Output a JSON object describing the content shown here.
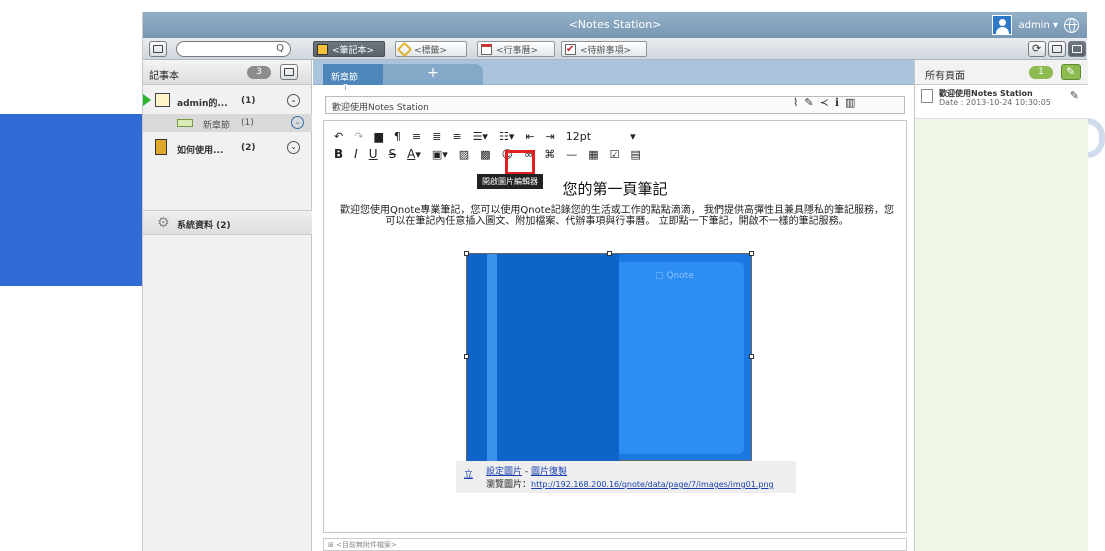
{
  "window": {
    "title": "<Notes Station>",
    "user": "admin ▾"
  },
  "toolbar": {
    "search_icon": "Q",
    "tabs": [
      {
        "label": "<筆記本>",
        "icon": "notebook-icon"
      },
      {
        "label": "<標籤>",
        "icon": "tag-icon"
      },
      {
        "label": "<行事曆>",
        "icon": "calendar-icon"
      },
      {
        "label": "<待辦事項>",
        "icon": "checkbox-icon"
      }
    ]
  },
  "sidebar": {
    "header": "記事本",
    "count": "3",
    "items": [
      {
        "label": "admin的...",
        "count": "(1)"
      },
      {
        "label": "新章節",
        "count": "(1)"
      },
      {
        "label": "如何使用...",
        "count": "(2)"
      }
    ],
    "system": "系統資料 (2)"
  },
  "editor": {
    "section_tab": "新章節",
    "add_tab": "+",
    "note_title": "歡迎使用Notes Station",
    "font_size": "12pt",
    "tooltip": "開啟圖片編輯器",
    "heading": "您的第一頁筆記",
    "paragraph": "歡迎您使用Qnote專業筆記，您可以使用Qnote記錄您的生活或工作的點點滴滴，  我們提供高彈性且兼具隱私的筆記服務，您可以在筆記內任意插入圖文、附加檔案、代辦事項與行事曆。 立即點一下筆記，開啟不一樣的筆記服務。",
    "image_logo": "▢ Qnote",
    "image_bar": {
      "mark": "立",
      "set_image": "設定圖片",
      "sep": " - ",
      "restore_image": "圖片復製",
      "browse_label": "瀏覽圖片：",
      "url": "http://192.168.200.16/qnote/data/page/7/images/img01.png"
    },
    "attachments": "⊞ <目前無附件檔案>"
  },
  "right_panel": {
    "header": "所有頁面",
    "count": "1",
    "note_title": "歡迎使用Notes Station",
    "note_date": "Date : 2013-10-24 10:30:05"
  },
  "colors": {
    "accent": "#2f6cd6",
    "highlight": "#e02020",
    "green": "#8dbb4f"
  }
}
